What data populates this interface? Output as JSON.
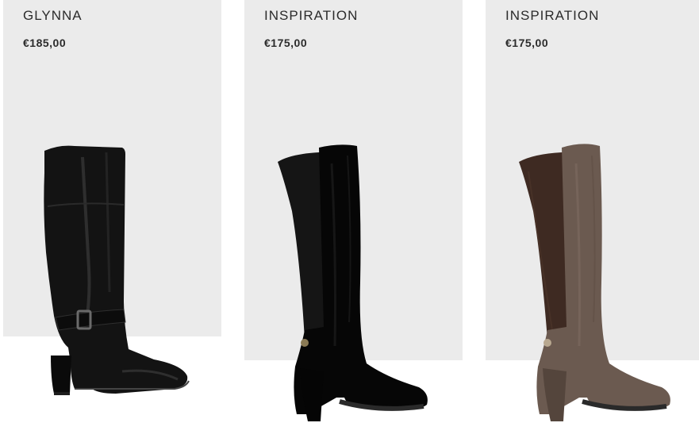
{
  "products": [
    {
      "name": "GLYNNA",
      "price": "€185,00",
      "image": "black-leather-knee-high-boot-with-buckle"
    },
    {
      "name": "INSPIRATION",
      "price": "€175,00",
      "image": "black-suede-stretch-knee-high-boot"
    },
    {
      "name": "INSPIRATION",
      "price": "€175,00",
      "image": "brown-suede-stretch-knee-high-boot"
    }
  ],
  "colors": {
    "card_background": "#ebebeb",
    "text": "#2b2b2b",
    "boot_black": "#111111",
    "boot_brown_suede": "#6b5a50",
    "boot_brown_stretch": "#3e2a22"
  }
}
